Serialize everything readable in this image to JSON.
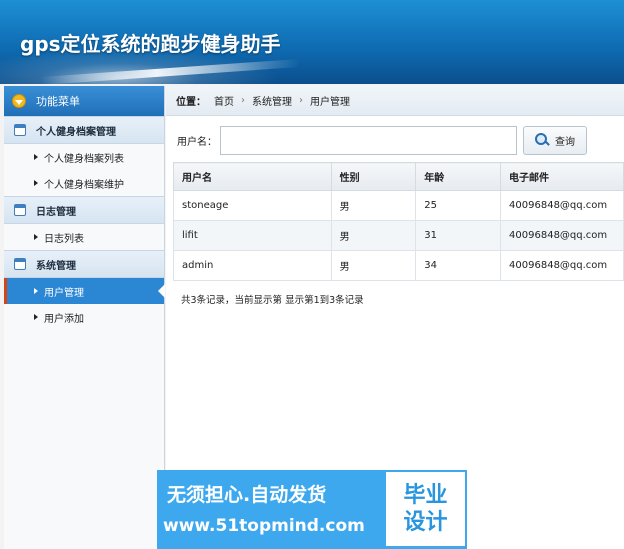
{
  "header": {
    "title": "gps定位系统的跑步健身助手"
  },
  "sidebar": {
    "top_label": "功能菜单",
    "groups": [
      {
        "label": "个人健身档案管理",
        "items": [
          "个人健身档案列表",
          "个人健身档案维护"
        ]
      },
      {
        "label": "日志管理",
        "items": [
          "日志列表"
        ]
      },
      {
        "label": "系统管理",
        "items": [
          "用户管理",
          "用户添加"
        ]
      }
    ],
    "active_item": "用户管理"
  },
  "breadcrumb": {
    "label": "位置：",
    "items": [
      "首页",
      "系统管理",
      "用户管理"
    ]
  },
  "search": {
    "label": "用户名：",
    "value": "",
    "button": "查询"
  },
  "table": {
    "headers": [
      "用户名",
      "性别",
      "年龄",
      "电子邮件"
    ],
    "rows": [
      [
        "stoneage",
        "男",
        "25",
        "40096848@qq.com"
      ],
      [
        "lifit",
        "男",
        "31",
        "40096848@qq.com"
      ],
      [
        "admin",
        "男",
        "34",
        "40096848@qq.com"
      ]
    ]
  },
  "summary": "共3条记录，当前显示第  显示第1到3条记录",
  "watermark": {
    "line1": "无须担心.自动发货",
    "line2": "www.51topmind.com",
    "right1": "毕业",
    "right2": "设计"
  },
  "colors": {
    "header": "#0f6db4",
    "active": "#2b86d4",
    "active_marker": "#d84315",
    "watermark": "#3ea8ee"
  }
}
